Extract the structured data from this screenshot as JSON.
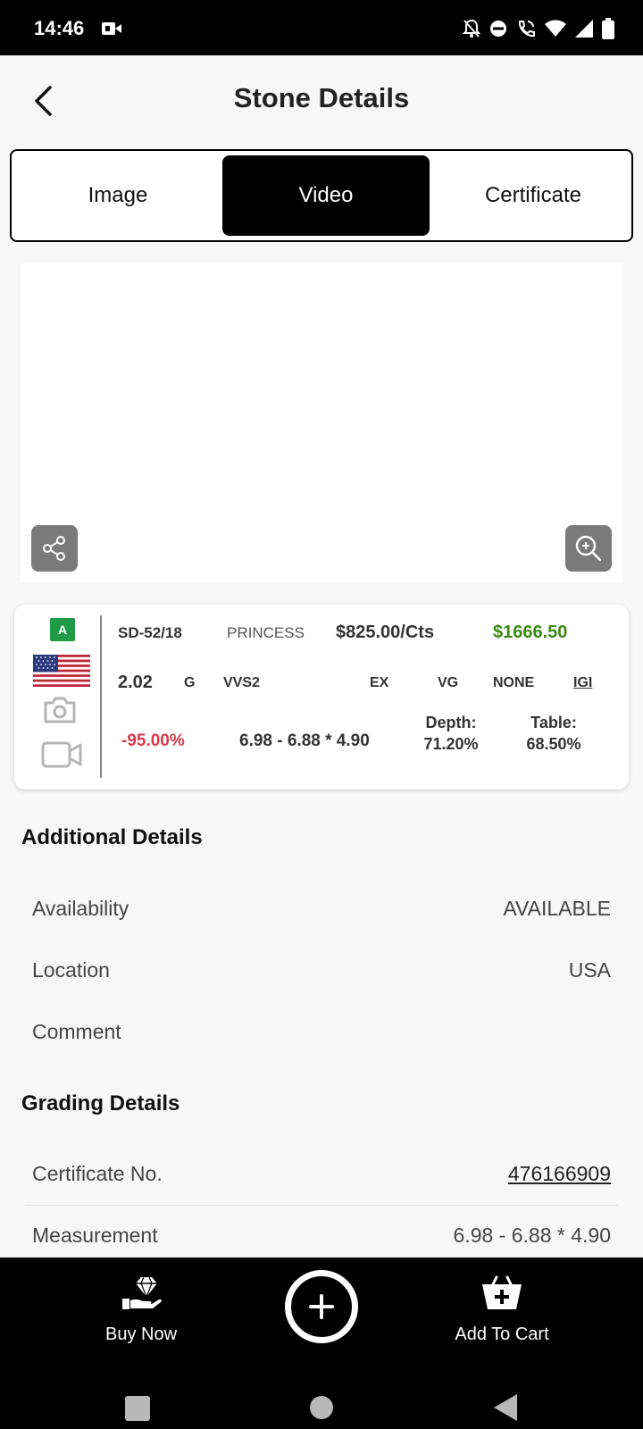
{
  "status_bar": {
    "time": "14:46",
    "icons": [
      "video-record-icon",
      "bell-off-icon",
      "dnd-icon",
      "wifi-call-icon",
      "wifi-icon",
      "signal-icon",
      "battery-icon"
    ]
  },
  "header": {
    "title": "Stone Details"
  },
  "tabs": [
    {
      "label": "Image",
      "active": false
    },
    {
      "label": "Video",
      "active": true
    },
    {
      "label": "Certificate",
      "active": false
    }
  ],
  "card": {
    "badge": "A",
    "stone_id": "SD-52/18",
    "shape": "PRINCESS",
    "price_per_ct": "$825.00/Cts",
    "total": "$1666.50",
    "carat": "2.02",
    "color": "G",
    "clarity": "VVS2",
    "cut": "EX",
    "polish": "VG",
    "fluorescence": "NONE",
    "lab": "IGI",
    "discount": "-95.00%",
    "measurement": "6.98 - 6.88 * 4.90",
    "depth_label": "Depth:",
    "depth_value": "71.20%",
    "table_label": "Table:",
    "table_value": "68.50%"
  },
  "additional": {
    "heading": "Additional Details",
    "rows": [
      {
        "label": "Availability",
        "value": "AVAILABLE"
      },
      {
        "label": "Location",
        "value": "USA"
      },
      {
        "label": "Comment",
        "value": ""
      }
    ]
  },
  "grading": {
    "heading": "Grading Details",
    "rows": [
      {
        "label": "Certificate No.",
        "value": "476166909"
      },
      {
        "label": "Measurement",
        "value": "6.98 - 6.88 * 4.90"
      }
    ]
  },
  "bottom": {
    "buy_now": "Buy Now",
    "add_to_cart": "Add To Cart"
  },
  "colors": {
    "accent": "#000000",
    "total_price": "#3a8a12",
    "discount": "#d83a4a",
    "badge": "#1f9a47"
  }
}
